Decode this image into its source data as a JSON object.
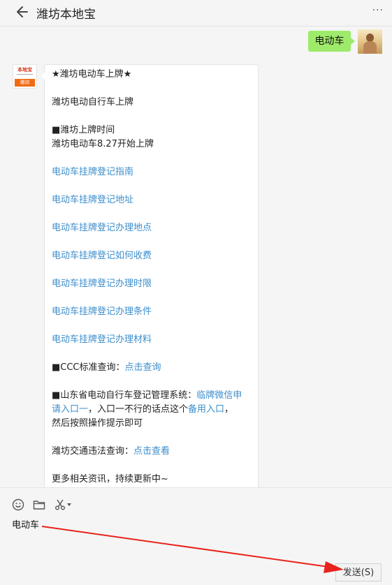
{
  "header": {
    "title": "潍坊本地宝",
    "more_label": "···"
  },
  "chat": {
    "outgoing_message": "电动车",
    "logo": {
      "top_text": "本地宝",
      "bottom_text": "潍坊"
    },
    "article": {
      "title": "★潍坊电动车上牌★",
      "subtitle": "潍坊电动自行车上牌",
      "section_time": "■潍坊上牌时间",
      "time_text": "潍坊电动车8.27开始上牌",
      "links": [
        "电动车挂牌登记指南",
        "电动车挂牌登记地址",
        "电动车挂牌登记办理地点",
        "电动车挂牌登记如何收费",
        "电动车挂牌登记办理时限",
        "电动车挂牌登记办理条件",
        "电动车挂牌登记办理材料"
      ],
      "ccc_label": "■CCC标准查询：",
      "ccc_link": "点击查询",
      "shandong_label": "■山东省电动自行车登记管理系统：",
      "shandong_link_1a": "临牌微信申",
      "shandong_link_1b": "请入口一",
      "shandong_mid": "，入口一不行的话点这个",
      "shandong_link_2": "备用入口",
      "shandong_end": "，",
      "shandong_line3": "然后按照操作提示即可",
      "traffic_label": "潍坊交通违法查询：",
      "traffic_link": "点击查看",
      "more_info": "更多相关资讯，持续更新中~"
    }
  },
  "input": {
    "typed_text": "电动车",
    "send_label": "发送(S)",
    "tools": [
      "emoji-icon",
      "folder-icon",
      "scissors-icon"
    ]
  },
  "colors": {
    "accent_green": "#9eea6a",
    "link_blue": "#3c8ecc",
    "arrow_red": "#e8231b"
  }
}
